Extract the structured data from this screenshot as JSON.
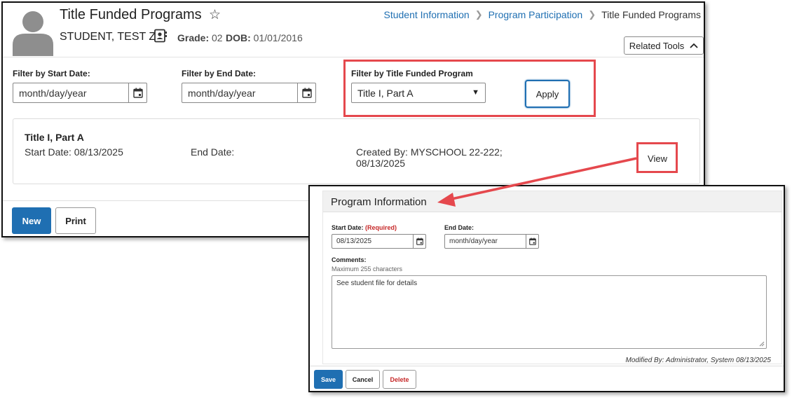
{
  "header": {
    "title": "Title Funded Programs",
    "student_name": "STUDENT, TEST Z",
    "grade_label": "Grade:",
    "grade_value": "02",
    "dob_label": "DOB:",
    "dob_value": "01/01/2016",
    "related_tools": "Related Tools"
  },
  "breadcrumb": {
    "items": [
      "Student Information",
      "Program Participation",
      "Title Funded Programs"
    ]
  },
  "filters": {
    "start_label": "Filter by Start Date:",
    "start_placeholder": "month/day/year",
    "end_label": "Filter by End Date:",
    "end_placeholder": "month/day/year",
    "program_label": "Filter by Title Funded Program",
    "program_selected": "Title I, Part A",
    "apply": "Apply"
  },
  "program_card": {
    "title": "Title I, Part A",
    "start": "Start Date: 08/13/2025",
    "end": "End Date:",
    "created_line1": "Created By: MYSCHOOL 22-222;",
    "created_line2": "08/13/2025",
    "view": "View"
  },
  "footer": {
    "new": "New",
    "print": "Print"
  },
  "popup": {
    "title": "Program Information",
    "start_label": "Start Date:",
    "start_required": "(Required)",
    "start_value": "08/13/2025",
    "end_label": "End Date:",
    "end_placeholder": "month/day/year",
    "comments_label": "Comments:",
    "comments_hint": "Maximum 255 characters",
    "comments_value": "See student file for details",
    "modified": "Modified By: Administrator, System 08/13/2025",
    "save": "Save",
    "cancel": "Cancel",
    "delete": "Delete"
  },
  "colors": {
    "accent": "#1f6fb2",
    "callout": "#e5484d",
    "delete_text": "#c62828"
  },
  "icons": [
    "user-avatar-icon",
    "star-icon",
    "contact-card-icon",
    "chevron-up-icon",
    "chevron-right-icon",
    "calendar-icon",
    "dropdown-arrow-icon",
    "resize-grip-icon"
  ]
}
